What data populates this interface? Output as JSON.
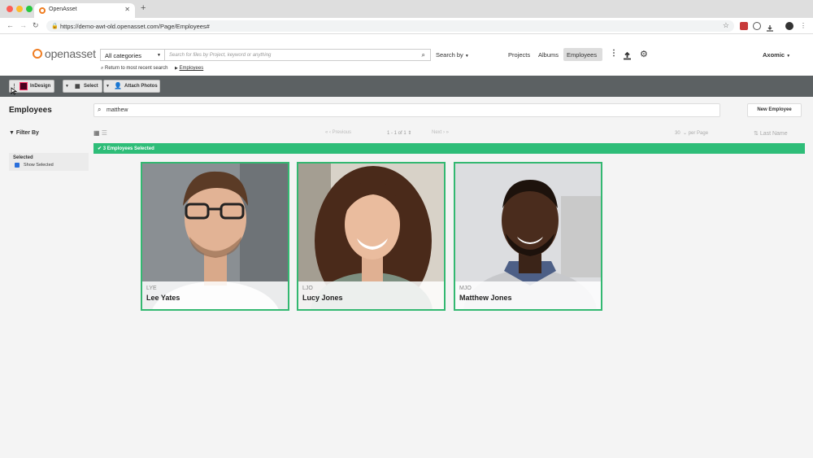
{
  "browser": {
    "tab_title": "OpenAsset",
    "url": "https://demo-awt-old.openasset.com/Page/Employees#"
  },
  "header": {
    "logo_text": "openasset",
    "category_select": "All categories",
    "search_placeholder": "Search for files by Project, keyword or anything",
    "search_by": "Search by",
    "return_link": "Return to most recent search",
    "breadcrumb": "Employees",
    "nav": {
      "projects": "Projects",
      "albums": "Albums",
      "employees": "Employees"
    },
    "user": "Axomic"
  },
  "toolbar": {
    "indesign": "InDesign",
    "select": "Select",
    "attach_photos": "Attach Photos"
  },
  "main": {
    "title": "Employees",
    "search_value": "matthew",
    "new_employee": "New Employee",
    "filter_by": "Filter By",
    "pagination": {
      "previous": "Previous",
      "range": "1 - 1 of 1",
      "next": "Next"
    },
    "per_page": {
      "value": "30",
      "label": "per Page"
    },
    "sort": "Last Name",
    "banner": "3 Employees Selected",
    "selected_heading": "Selected",
    "show_selected": "Show Selected"
  },
  "employees": [
    {
      "code": "LYE",
      "name": "Lee Yates"
    },
    {
      "code": "LJO",
      "name": "Lucy Jones"
    },
    {
      "code": "MJO",
      "name": "Matthew Jones"
    }
  ],
  "colors": {
    "accent": "#ef7d22",
    "selected": "#2ebd78",
    "toolbar": "#5c6163"
  },
  "icons": {
    "search": "search-icon",
    "upload": "upload-icon",
    "settings": "gear-icon",
    "more": "more-vertical-icon",
    "grid": "grid-view-icon",
    "list": "list-view-icon",
    "check": "check-icon"
  }
}
